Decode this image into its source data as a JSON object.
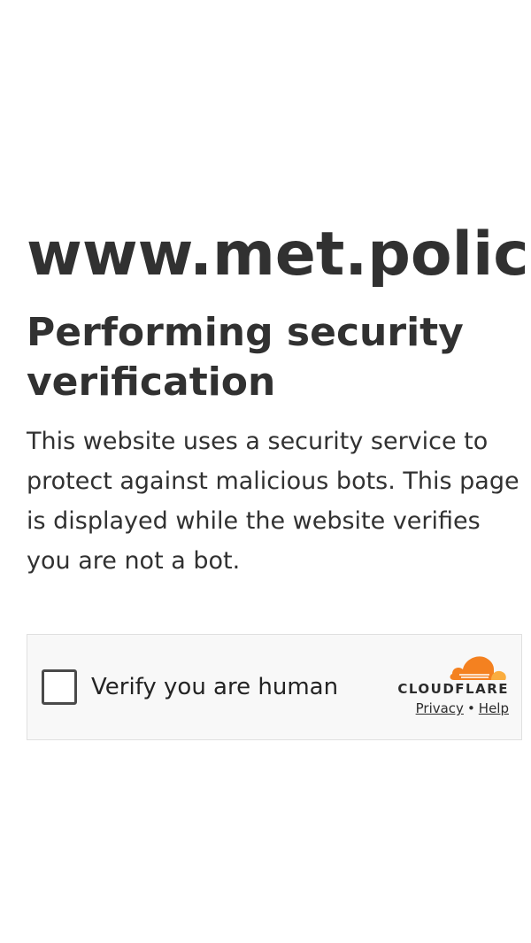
{
  "page": {
    "domain_title": "www.met.police.uk",
    "heading": "Performing security verification",
    "description": "This website uses a security service to protect against malicious bots. This page is displayed while the website verifies you are not a bot."
  },
  "challenge": {
    "checkbox_label": "Verify you are human",
    "checked": false,
    "brand_name": "CLOUDFLARE",
    "privacy_link": "Privacy",
    "separator": "•",
    "help_link": "Help",
    "brand_colors": {
      "orange": "#f48120",
      "light_orange": "#faad3f"
    }
  },
  "icons": {
    "brand_logo": "cloudflare-cloud-icon"
  }
}
